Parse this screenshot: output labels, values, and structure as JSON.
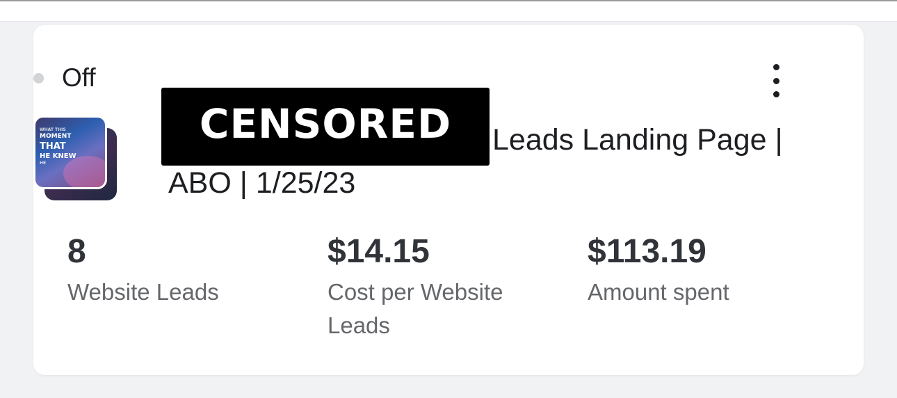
{
  "status": {
    "label": "Off",
    "dot_color": "#d2d4d8"
  },
  "menu": {
    "icon": "more-vertical-icon"
  },
  "ad": {
    "thumbnail_text": [
      "WHAT THIS",
      "MOMENT",
      "THAT",
      "HE KNEW",
      "HE"
    ],
    "censor_label": "CENSORED",
    "title_part1": "Leads Landing Page |",
    "title_part2": "ABO | 1/25/23"
  },
  "metrics": [
    {
      "value": "8",
      "label": "Website Leads"
    },
    {
      "value": "$14.15",
      "label": "Cost per Website Leads"
    },
    {
      "value": "$113.19",
      "label": "Amount spent"
    }
  ]
}
